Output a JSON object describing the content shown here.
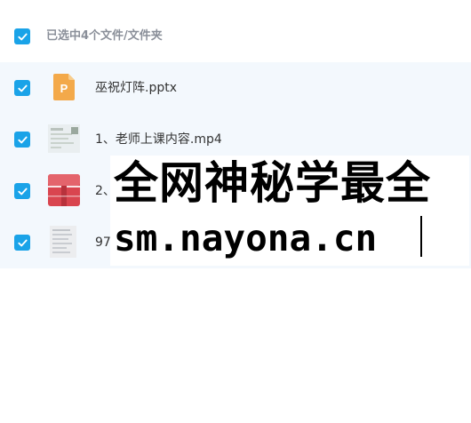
{
  "header": {
    "label": "已选中4个文件/文件夹"
  },
  "files": [
    {
      "name": "巫祝灯阵.pptx",
      "icon": "ppt-file-icon"
    },
    {
      "name": "1、老师上课内容.mp4",
      "icon": "video-thumbnail"
    },
    {
      "name": "2、",
      "icon": "archive-file-icon"
    },
    {
      "name": "97",
      "icon": "document-thumbnail"
    }
  ],
  "watermark": {
    "line1": "全网神秘学最全",
    "line2": "sm.nayona.cn"
  },
  "colors": {
    "checkbox": "#1aa3e8",
    "list_background": "#f3f8fd",
    "ppt_orange": "#f3a94a",
    "archive_red": "#d9454f"
  }
}
